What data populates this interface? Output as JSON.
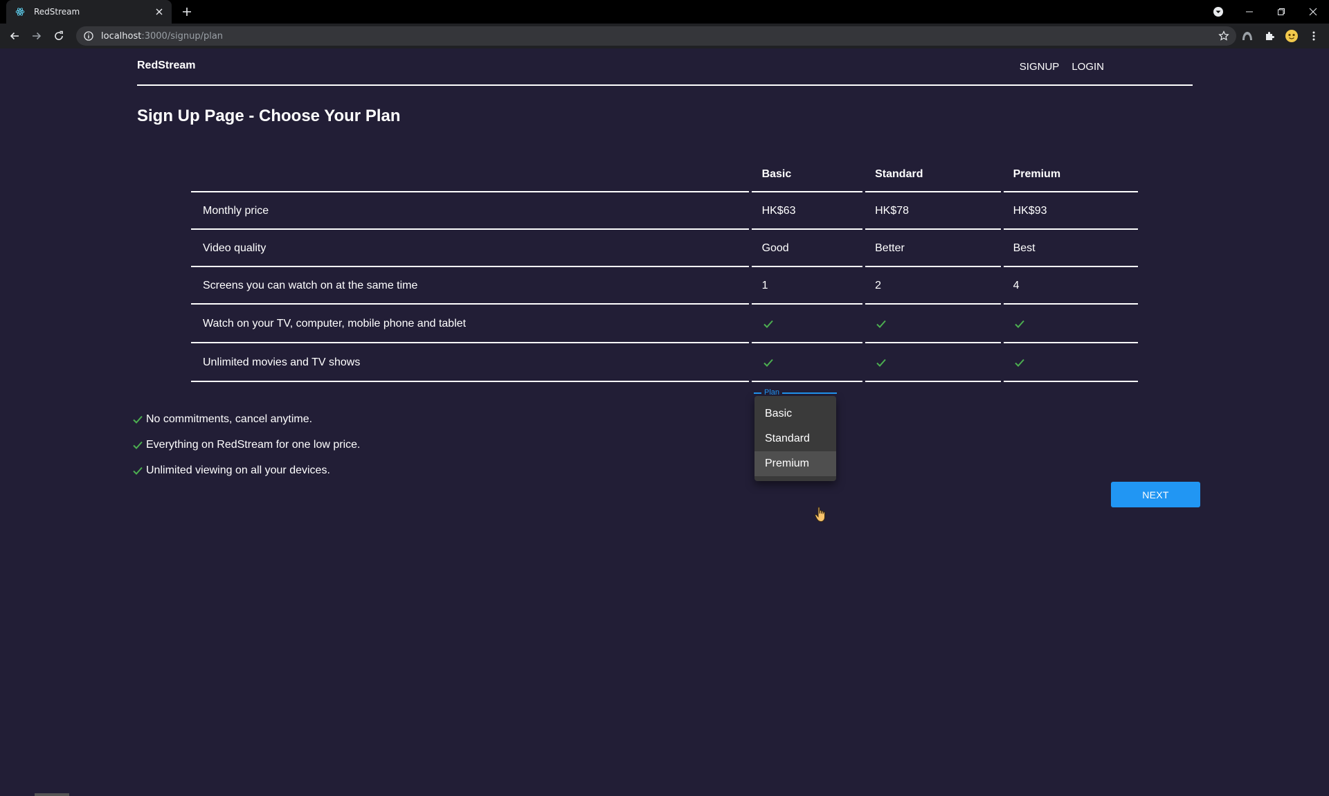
{
  "browser": {
    "tab_title": "RedStream",
    "url_host": "localhost",
    "url_path": ":3000/signup/plan"
  },
  "nav": {
    "brand": "RedStream",
    "links": [
      "SIGNUP",
      "LOGIN"
    ]
  },
  "page": {
    "title": "Sign Up Page - Choose Your Plan"
  },
  "table": {
    "headers": [
      "Basic",
      "Standard",
      "Premium"
    ],
    "rows": [
      {
        "feature": "Monthly price",
        "values": [
          "HK$63",
          "HK$78",
          "HK$93"
        ]
      },
      {
        "feature": "Video quality",
        "values": [
          "Good",
          "Better",
          "Best"
        ]
      },
      {
        "feature": "Screens you can watch on at the same time",
        "values": [
          "1",
          "2",
          "4"
        ]
      },
      {
        "feature": "Watch on your TV, computer, mobile phone and tablet",
        "values": [
          "check",
          "check",
          "check"
        ]
      },
      {
        "feature": "Unlimited movies and TV shows",
        "values": [
          "check",
          "check",
          "check"
        ]
      }
    ]
  },
  "benefits": [
    "No commitments, cancel anytime.",
    "Everything on RedStream for one low price.",
    "Unlimited viewing on all your devices."
  ],
  "select": {
    "label": "Plan",
    "options": [
      "Basic",
      "Standard",
      "Premium"
    ],
    "highlighted": "Premium"
  },
  "next_label": "NEXT",
  "colors": {
    "background": "#221e36",
    "accent": "#2196f3",
    "check": "#4caf50"
  }
}
